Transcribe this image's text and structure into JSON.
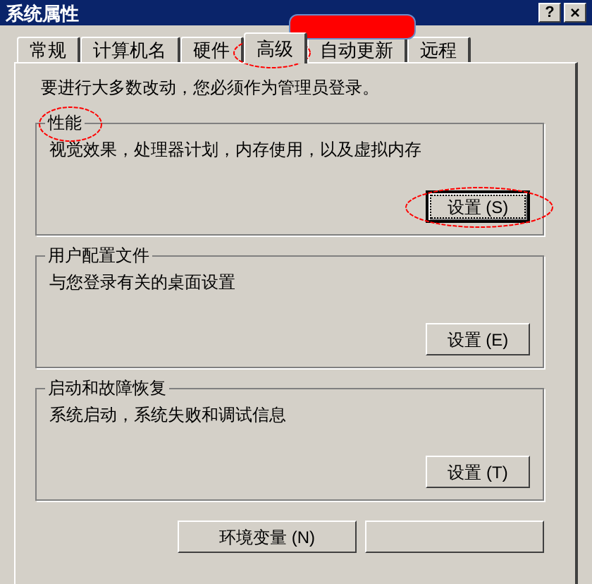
{
  "window": {
    "title": "系统属性",
    "help_button": "?",
    "close_button": "×"
  },
  "tabs": [
    {
      "label": "常规",
      "selected": false
    },
    {
      "label": "计算机名",
      "selected": false
    },
    {
      "label": "硬件",
      "selected": false
    },
    {
      "label": "高级",
      "selected": true
    },
    {
      "label": "自动更新",
      "selected": false
    },
    {
      "label": "远程",
      "selected": false
    }
  ],
  "notice": "要进行大多数改动，您必须作为管理员登录。",
  "groups": [
    {
      "title": "性能",
      "description": "视觉效果，处理器计划，内存使用，以及虚拟内存",
      "button": "设置 (S)",
      "focused": true
    },
    {
      "title": "用户配置文件",
      "description": "与您登录有关的桌面设置",
      "button": "设置 (E)",
      "focused": false
    },
    {
      "title": "启动和故障恢复",
      "description": "系统启动，系统失败和调试信息",
      "button": "设置 (T)",
      "focused": false
    }
  ],
  "bottom_buttons": [
    "环境变量 (N)"
  ]
}
